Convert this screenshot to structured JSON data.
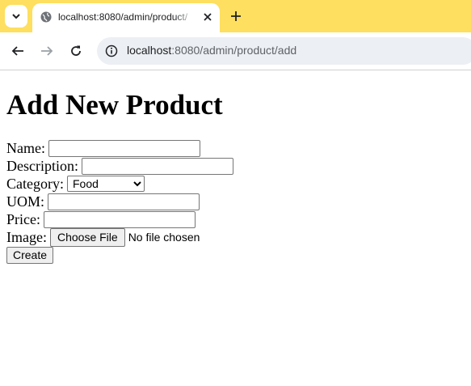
{
  "browser": {
    "tab_title": "localhost:8080/admin/product/",
    "url_host": "localhost",
    "url_path": ":8080/admin/product/add",
    "tab_bar_color": "#fedf5f"
  },
  "page": {
    "heading": "Add New Product",
    "fields": {
      "name_label": "Name:",
      "description_label": "Description:",
      "category_label": "Category:",
      "category_selected": "Food",
      "uom_label": "UOM:",
      "price_label": "Price:",
      "image_label": "Image:",
      "file_button": "Choose File",
      "file_status": "No file chosen"
    },
    "submit_label": "Create"
  }
}
